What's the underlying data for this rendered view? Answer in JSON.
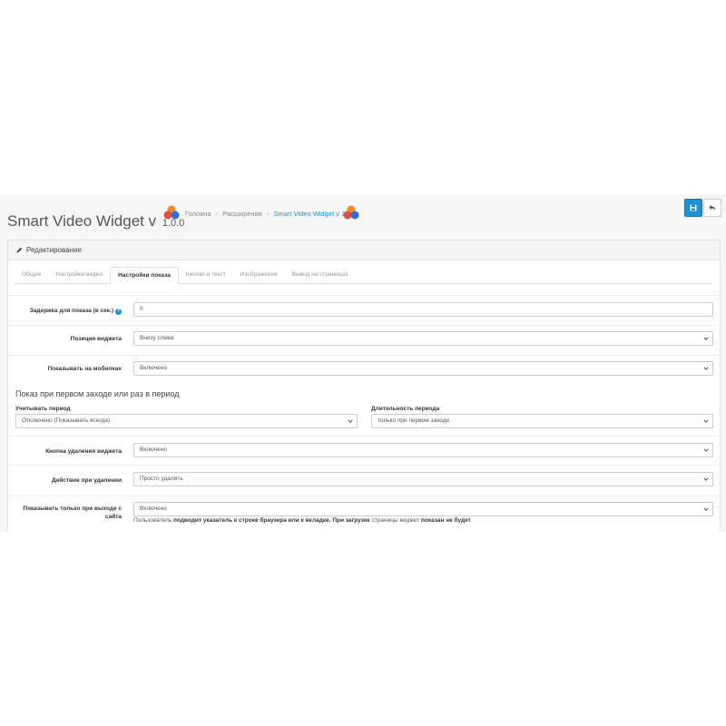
{
  "header": {
    "title": "Smart Video Widget v",
    "version": "1.0.0",
    "breadcrumb": [
      {
        "label": "Головна"
      },
      {
        "label": "Расширения"
      },
      {
        "label": "Smart Video Widget v 1.0.0"
      }
    ],
    "save_icon": "save-icon",
    "back_icon": "reply-icon"
  },
  "panel": {
    "heading": "Редактирование",
    "heading_icon": "pencil-icon"
  },
  "tabs": [
    {
      "label": "Общие",
      "active": false
    },
    {
      "label": "Настройки видео",
      "active": false
    },
    {
      "label": "Настройки показа",
      "active": true
    },
    {
      "label": "Кнопки и текст",
      "active": false
    },
    {
      "label": "Изображения",
      "active": false
    },
    {
      "label": "Вывод на страницах",
      "active": false
    }
  ],
  "fields": {
    "delay": {
      "label": "Задержка для показа (в сек.)",
      "value": "0"
    },
    "position": {
      "label": "Позиция виджета",
      "value": "Внизу слева"
    },
    "mobile": {
      "label": "Показывать на мобилках",
      "value": "Включено"
    },
    "section_title": "Показ при первом заходе или раз в период",
    "period": {
      "label": "Учитывать период",
      "value": "Отключено (Показывать всегда)"
    },
    "period_length": {
      "label": "Длительность периода",
      "value": "только при первом заходе"
    },
    "close_button": {
      "label": "Кнопка удаления виджета",
      "value": "Включено"
    },
    "close_action": {
      "label": "Действие при удалении",
      "value": "Просто удалить"
    },
    "exit_only": {
      "label": "Показывать только при выходе с сайта",
      "value": "Включено",
      "help": {
        "t1": "Пользователь",
        "b1": "подводит указатель к строке браузера или к вкладке.",
        "t2": "При загрузке",
        "t3": "страницы виджет",
        "b2": "показан не будет"
      }
    }
  },
  "colors": {
    "primary": "#1e91cf",
    "background": "#f6f6f6",
    "logo_orange": "#f28c28",
    "logo_red": "#e74c3c",
    "logo_blue": "#2f6fd6"
  }
}
